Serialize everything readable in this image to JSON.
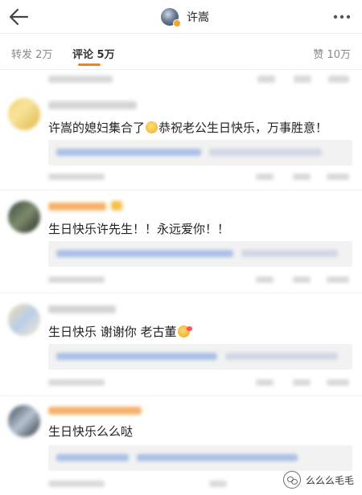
{
  "header": {
    "title": "许嵩",
    "back_icon": "arrow-left-icon",
    "more_icon": "more-horizontal-icon"
  },
  "tabs": [
    {
      "label": "转发 2万",
      "active": false
    },
    {
      "label": "评论 5万",
      "active": true
    },
    {
      "label": "赞 10万",
      "active": false
    }
  ],
  "comments": [
    {
      "text_before": "许嵩的媳妇集合了",
      "emoji": "clap-emoji",
      "text_after": "恭祝老公生日快乐，万事胜意！"
    },
    {
      "text_before": "生日快乐许先生！！永远爱你！！",
      "emoji": "",
      "text_after": ""
    },
    {
      "text_before": "生日快乐 谢谢你 老古董",
      "emoji": "kiss-emoji",
      "text_after": ""
    },
    {
      "text_before": "生日快乐么么哒",
      "emoji": "",
      "text_after": ""
    }
  ],
  "watermark": {
    "text": "么么么毛毛"
  },
  "colors": {
    "accent": "#ff8200",
    "reply_bg": "#f2f2f2",
    "blur_blue": "#aac0e6",
    "blur_gray": "#d9d9d9",
    "blur_orange": "#f6b26b"
  }
}
